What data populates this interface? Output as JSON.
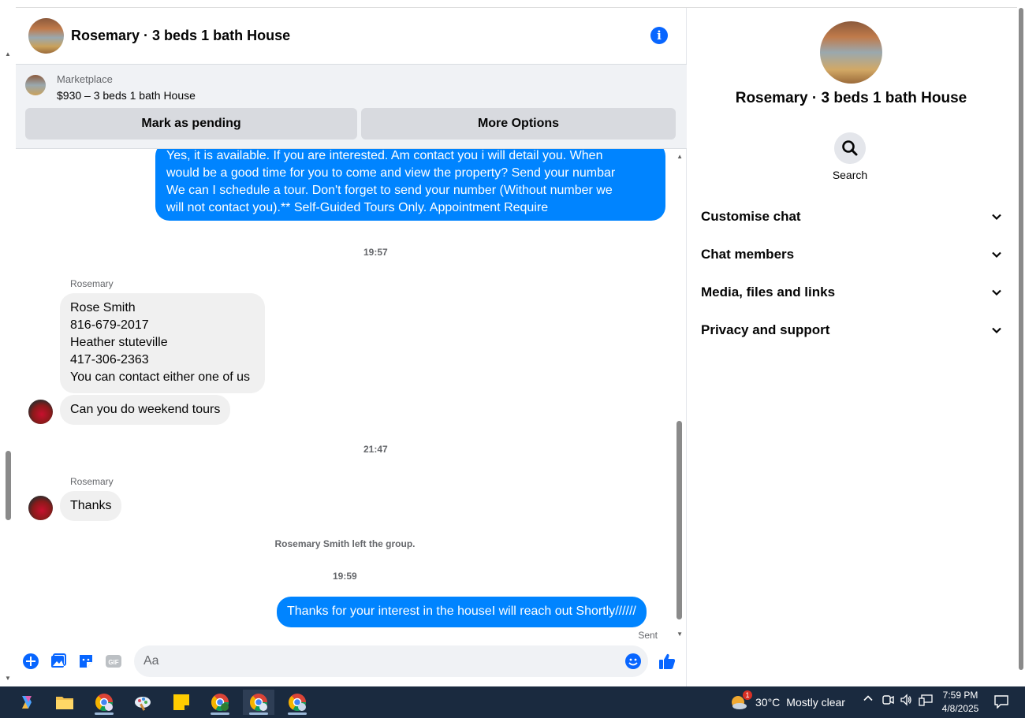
{
  "chat": {
    "title": "Rosemary · 3 beds 1 bath House",
    "marketplace_label": "Marketplace",
    "listing": "$930 – 3 beds 1 bath House",
    "mark_pending": "Mark as pending",
    "more_options": "More Options"
  },
  "messages": {
    "outgoing_1_lines": [
      "Yes, it is available. If you are interested.  Am contact you i will detail you.  When",
      "would be a good time for you to come and view the property? Send your numbar",
      "We can I schedule a tour.  Don't forget to send your number (Without number we",
      "will not contact you).** Self-Guided Tours Only. Appointment Require"
    ],
    "time_1": "19:57",
    "sender_1": "Rosemary",
    "incoming_1_lines": [
      "Rose Smith",
      "816-679-2017",
      "Heather stuteville",
      "417-306-2363",
      "You can contact either one of us"
    ],
    "incoming_2": "Can you do weekend tours",
    "time_2": "21:47",
    "sender_2": "Rosemary",
    "incoming_3": "Thanks",
    "system_notice": "Rosemary Smith left the group.",
    "time_3": "19:59",
    "outgoing_2": "Thanks for your interest in the houseI will reach out Shortly//////",
    "status": "Sent"
  },
  "composer": {
    "placeholder": "Aa"
  },
  "panel": {
    "title": "Rosemary · 3 beds 1 bath House",
    "search_label": "Search",
    "sections": [
      "Customise chat",
      "Chat members",
      "Media, files and links",
      "Privacy and support"
    ]
  },
  "taskbar": {
    "temperature": "30°C",
    "weather": "Mostly clear",
    "weather_badge": "1",
    "time": "7:59 PM",
    "date": "4/8/2025"
  },
  "colors": {
    "accent": "#0866ff",
    "outgoing_bubble": "#0084ff",
    "incoming_bubble": "#f0f0f0",
    "taskbar": "#1a2a3f"
  }
}
